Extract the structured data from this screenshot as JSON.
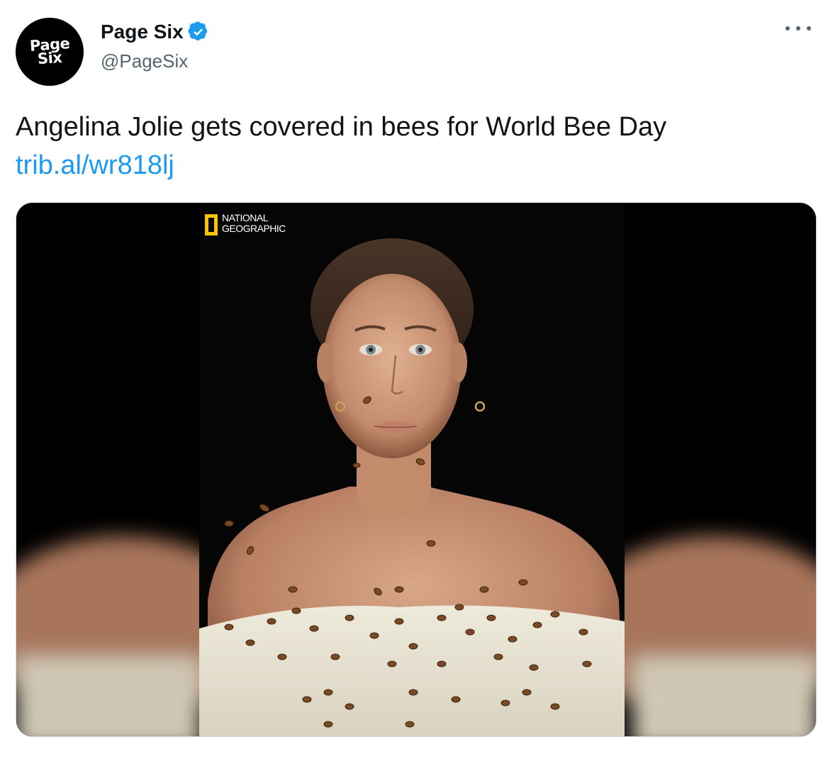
{
  "account": {
    "avatar_line1": "Page",
    "avatar_line2": "Six",
    "display_name": "Page Six",
    "handle": "@PageSix",
    "verified": true
  },
  "tweet": {
    "text": "Angelina Jolie gets covered in bees for World Bee Day",
    "link": "trib.al/wr818lj"
  },
  "media": {
    "logo_line1": "NATIONAL",
    "logo_line2": "GEOGRAPHIC",
    "logo_color": "#f8c300"
  },
  "icons": {
    "verified": "verified-badge-icon",
    "more": "more-options-icon"
  },
  "colors": {
    "text": "#0f1419",
    "secondary": "#536471",
    "link": "#1d9bf0",
    "verified": "#1d9bf0"
  }
}
